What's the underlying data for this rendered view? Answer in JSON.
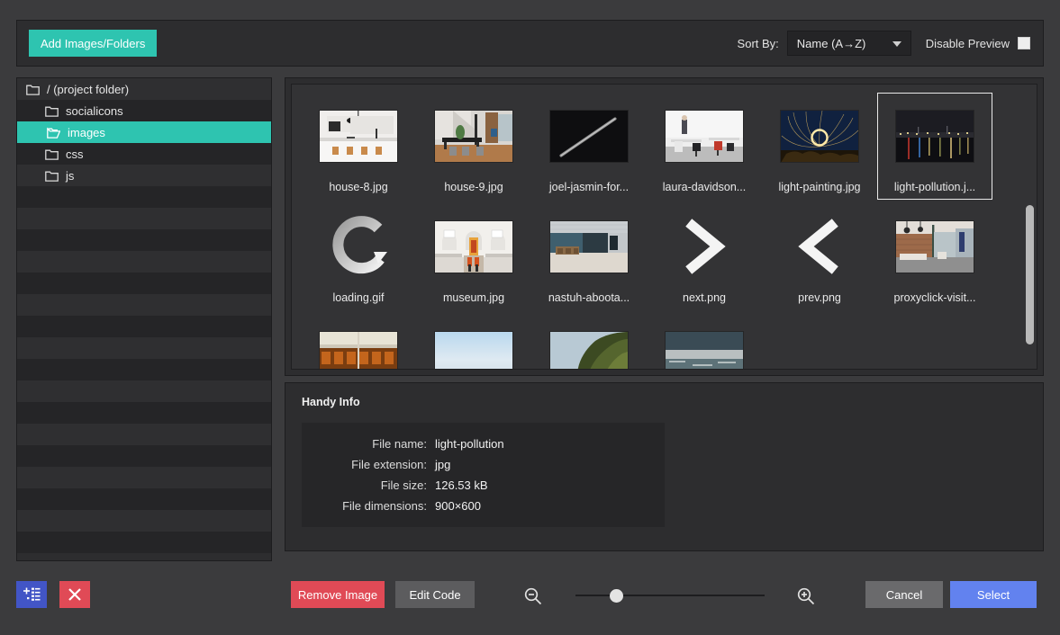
{
  "toolbar": {
    "add_button": "Add Images/Folders",
    "sort_label": "Sort By:",
    "sort_value": "Name (A→Z)",
    "disable_preview_label": "Disable Preview"
  },
  "tree": {
    "items": [
      {
        "label": "/ (project folder)",
        "level": 0,
        "selected": false,
        "icon": "folder-icon"
      },
      {
        "label": "socialicons",
        "level": 1,
        "selected": false,
        "icon": "folder-icon"
      },
      {
        "label": "images",
        "level": 1,
        "selected": true,
        "icon": "folder-open-icon"
      },
      {
        "label": "css",
        "level": 1,
        "selected": false,
        "icon": "folder-icon"
      },
      {
        "label": "js",
        "level": 1,
        "selected": false,
        "icon": "folder-icon"
      }
    ],
    "empty_row_count": 17
  },
  "grid": {
    "items": [
      {
        "label": "house-8.jpg",
        "kind": "photo-kitchen",
        "selected": false
      },
      {
        "label": "house-9.jpg",
        "kind": "photo-livingroom",
        "selected": false
      },
      {
        "label": "joel-jasmin-for...",
        "kind": "photo-dark-diagonal",
        "selected": false
      },
      {
        "label": "laura-davidson...",
        "kind": "photo-office",
        "selected": false
      },
      {
        "label": "light-painting.jpg",
        "kind": "photo-lightpainting",
        "selected": false
      },
      {
        "label": "light-pollution.j...",
        "kind": "photo-nightharbor",
        "selected": true
      },
      {
        "label": "loading.gif",
        "kind": "spinner-icon",
        "selected": false
      },
      {
        "label": "museum.jpg",
        "kind": "photo-museum",
        "selected": false
      },
      {
        "label": "nastuh-aboota...",
        "kind": "photo-lobby",
        "selected": false
      },
      {
        "label": "next.png",
        "kind": "chevron-right-icon",
        "selected": false
      },
      {
        "label": "prev.png",
        "kind": "chevron-left-icon",
        "selected": false
      },
      {
        "label": "proxyclick-visit...",
        "kind": "photo-workspace",
        "selected": false
      },
      {
        "label": "",
        "kind": "photo-clipped-warehouse",
        "selected": false
      },
      {
        "label": "",
        "kind": "photo-clipped-sky",
        "selected": false
      },
      {
        "label": "",
        "kind": "photo-clipped-tree",
        "selected": false
      },
      {
        "label": "",
        "kind": "photo-clipped-shore",
        "selected": false
      }
    ]
  },
  "info": {
    "title": "Handy Info",
    "rows": [
      {
        "key": "File name:",
        "value": "light-pollution"
      },
      {
        "key": "File extension:",
        "value": "jpg"
      },
      {
        "key": "File size:",
        "value": "126.53 kB"
      },
      {
        "key": "File dimensions:",
        "value": "900×600"
      }
    ]
  },
  "bottom": {
    "remove_label": "Remove Image",
    "edit_label": "Edit Code",
    "cancel_label": "Cancel",
    "select_label": "Select",
    "zoom_out_icon": "zoom-out-icon",
    "zoom_in_icon": "zoom-in-icon",
    "slider_position_percent": 18
  },
  "colors": {
    "accent_teal": "#2ec4b0",
    "danger_red": "#e04a56",
    "primary_blue": "#6282ef",
    "icon_blue": "#4255c6",
    "panel_bg": "#2d2d2f",
    "window_bg": "#3b3b3d"
  }
}
